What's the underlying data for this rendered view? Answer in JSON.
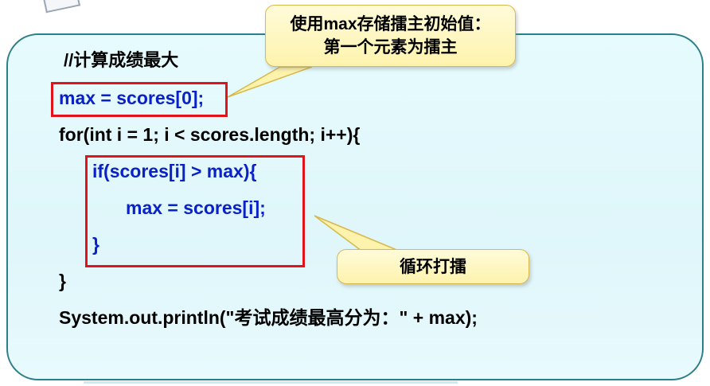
{
  "code": {
    "comment": "//计算成绩最大",
    "line1": "max = scores[0];",
    "line2": "for(int i = 1; i < scores.length; i++){",
    "line3": "if(scores[i] > max){",
    "line4": "max = scores[i];",
    "line5": "}",
    "line6": "}",
    "line7": "System.out.println(\"考试成绩最高分为：\" + max);"
  },
  "callouts": {
    "top": {
      "line1": "使用max存储擂主初始值：",
      "line2": "第一个元素为擂主"
    },
    "bottom": {
      "label": "循环打擂"
    }
  },
  "colors": {
    "code_highlight": "#0a21c8",
    "box_border": "#e0141a",
    "panel_border": "#2d7f87",
    "panel_fill": "#e2f8fb",
    "callout_fill": "#fdf3ad"
  }
}
